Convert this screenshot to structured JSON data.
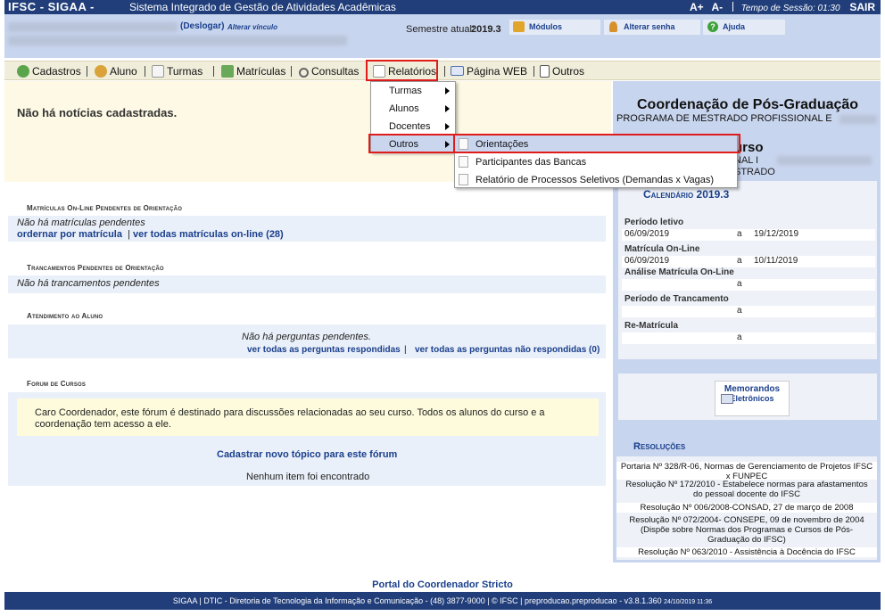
{
  "header": {
    "brand": "IFSC - SIGAA -",
    "system_title": "Sistema Integrado de Gestão de Atividades Acadêmicas",
    "font_increase": "A+",
    "font_decrease": "A-",
    "session_label": "Tempo de Sessão: 01:30",
    "logout": "SAIR"
  },
  "user": {
    "logout_link": "(Deslogar)",
    "change_link": "Alterar vínculo",
    "semester_label": "Semestre atual:",
    "semester_value": "2019.3",
    "modules": "Módulos",
    "change_password": "Alterar senha",
    "help": "Ajuda"
  },
  "menu": {
    "items": [
      "Cadastros",
      "Aluno",
      "Turmas",
      "Matrículas",
      "Consultas",
      "Relatórios",
      "Página WEB",
      "Outros"
    ]
  },
  "dropdown": {
    "items": [
      "Turmas",
      "Alunos",
      "Docentes",
      "Outros"
    ],
    "submenu": [
      "Orientações",
      "Participantes das Bancas",
      "Relatório de Processos Seletivos (Demandas x Vagas)"
    ]
  },
  "news": {
    "text": "Não há notícias cadastradas."
  },
  "sections": {
    "matriculas_title": "Matrículas On-Line Pendentes de Orientação",
    "matriculas_empty": "Não há matrículas pendentes",
    "matriculas_link1": "ordernar por matrícula",
    "matriculas_sep": "|",
    "matriculas_link2": "ver todas matrículas on-line (28)",
    "trancamentos_title": "Trancamentos Pendentes de Orientação",
    "trancamentos_empty": "Não há trancamentos pendentes",
    "atendimento_title": "Atendimento ao Aluno",
    "atendimento_empty": "Não há perguntas pendentes.",
    "atendimento_link1": "ver todas as perguntas respondidas",
    "atendimento_sep": "|",
    "atendimento_link2": "ver todas as perguntas não respondidas (0)",
    "forum_title": "Forum de Cursos",
    "forum_text": "Caro Coordenador, este fórum é destinado para discussões relacionadas ao seu curso. Todos os alunos do curso e a coordenação tem acesso a ele.",
    "forum_link": "Cadastrar novo tópico para este fórum",
    "forum_empty": "Nenhum item foi encontrado"
  },
  "right": {
    "coord_title": "Coordenação de Pós-Graduação",
    "coord_sub": "PROGRAMA DE MESTRADO PROFISSIONAL E",
    "course_title": "urso",
    "course_line1": "NAL I",
    "course_line2": "STRADO",
    "calendar_title": "Calendário 2019.3",
    "periods": [
      {
        "label": "Período letivo",
        "start": "06/09/2019",
        "sep": "a",
        "end": "19/12/2019"
      },
      {
        "label": "Matrícula On-Line",
        "start": "06/09/2019",
        "sep": "a",
        "end": "10/11/2019"
      },
      {
        "label": "Análise Matrícula On-Line",
        "start": "",
        "sep": "a",
        "end": ""
      },
      {
        "label": "Período de Trancamento",
        "start": "",
        "sep": "a",
        "end": ""
      },
      {
        "label": "Re-Matrícula",
        "start": "",
        "sep": "a",
        "end": ""
      }
    ],
    "memo_line1": "Memorandos",
    "memo_line2": "Eletrônicos",
    "resolutions_title": "Resoluções",
    "resolutions": [
      "Portaria Nº 328/R-06, Normas de Gerenciamento de Projetos IFSC x FUNPEC",
      "Resolução Nº 172/2010 - Estabelece normas para afastamentos do pessoal docente do IFSC",
      "Resolução Nº 006/2008-CONSAD, 27 de março de 2008",
      "Resolução Nº 072/2004- CONSEPE, 09 de novembro de 2004 (Dispõe sobre Normas dos Programas e Cursos de Pós-Graduação do IFSC)",
      "Resolução Nº 063/2010 - Assistência à Docência do IFSC"
    ]
  },
  "footer": {
    "portal": "Portal do Coordenador Stricto",
    "text": "SIGAA | DTIC - Diretoria de Tecnologia da Informação e Comunicação - (48) 3877-9000 | © IFSC | preproducao.preproducao - v3.8.1.360",
    "timestamp": "24/10/2019 11:36"
  },
  "colors": {
    "header_bg": "#213e7a",
    "user_bg": "#c8d5ee",
    "menu_bg": "#f0eeda",
    "link": "#1a3f8c",
    "highlight": "#e01b1b"
  }
}
